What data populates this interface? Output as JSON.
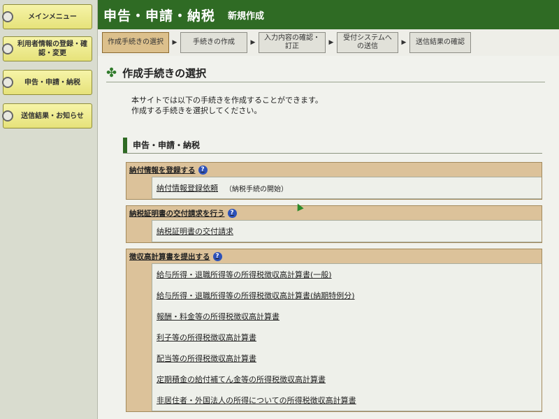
{
  "sidebar": {
    "items": [
      {
        "label": "メインメニュー"
      },
      {
        "label": "利用者情報の登録・確認・変更"
      },
      {
        "label": "申告・申請・納税"
      },
      {
        "label": "送信結果・お知らせ"
      }
    ]
  },
  "header": {
    "title": "申告・申請・納税",
    "subtitle": "新規作成"
  },
  "steps": [
    {
      "label": "作成手続きの選択",
      "active": true
    },
    {
      "label": "手続きの作成"
    },
    {
      "label": "入力内容の確認・訂正"
    },
    {
      "label": "受付システムへの送信"
    },
    {
      "label": "送信結果の確認"
    }
  ],
  "main": {
    "section_title": "作成手続きの選択",
    "intro_line1": "本サイトでは以下の手続きを作成することができます。",
    "intro_line2": "作成する手続きを選択してください。",
    "category": "申告・申請・納税",
    "groups": [
      {
        "title": "納付情報を登録する",
        "items": [
          {
            "label": "納付情報登録依頼",
            "note": "（納税手続の開始）"
          }
        ]
      },
      {
        "title": "納税証明書の交付請求を行う",
        "items": [
          {
            "label": "納税証明書の交付請求"
          }
        ]
      },
      {
        "title": "徴収高計算書を提出する",
        "items": [
          {
            "label": "給与所得・退職所得等の所得税徴収高計算書(一般)"
          },
          {
            "label": "給与所得・退職所得等の所得税徴収高計算書(納期特例分)"
          },
          {
            "label": "報酬・料金等の所得税徴収高計算書"
          },
          {
            "label": "利子等の所得税徴収高計算書"
          },
          {
            "label": "配当等の所得税徴収高計算書"
          },
          {
            "label": "定期積金の給付補てん金等の所得税徴収高計算書"
          },
          {
            "label": "非居住者・外国法人の所得についての所得税徴収高計算書"
          }
        ]
      }
    ],
    "help_icon": "?"
  }
}
